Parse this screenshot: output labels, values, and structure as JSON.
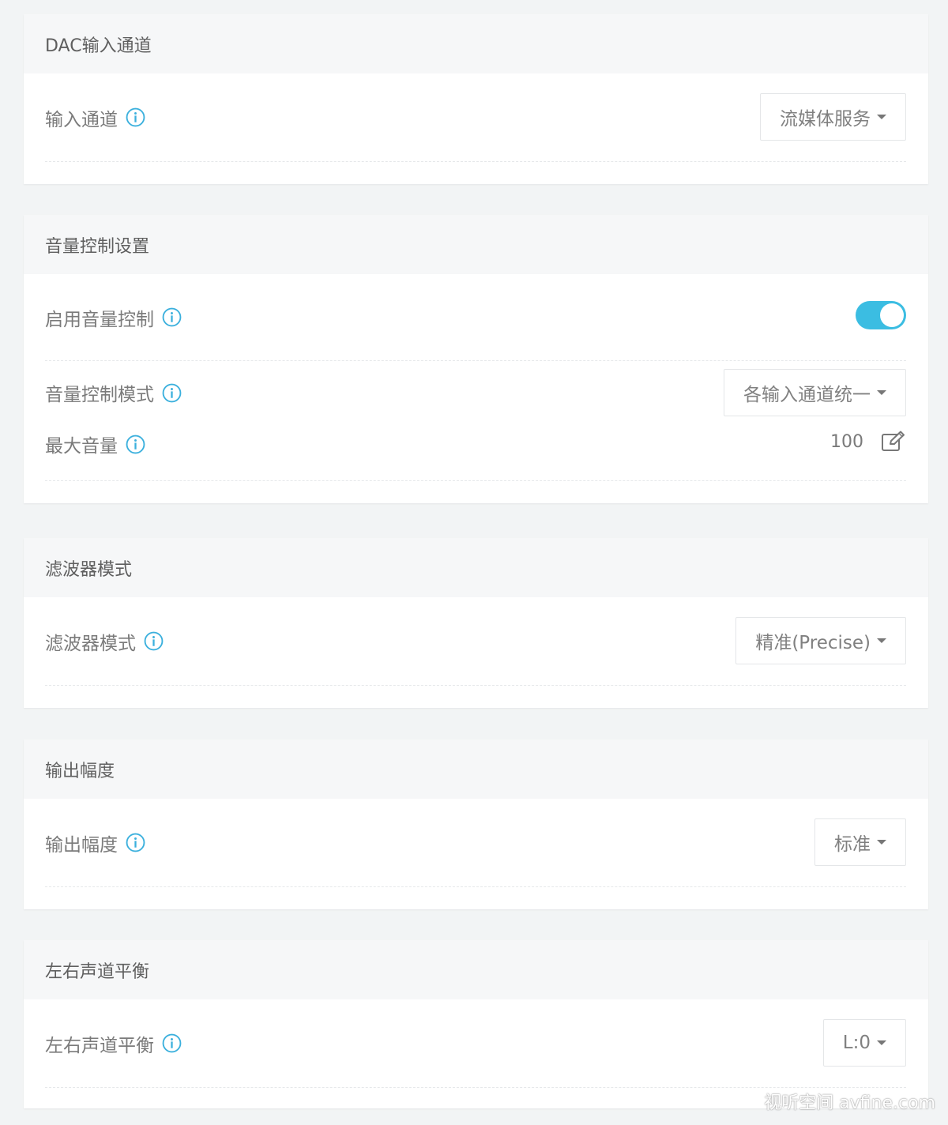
{
  "sections": {
    "dac": {
      "title": "DAC输入通道",
      "input_channel": {
        "label": "输入通道",
        "value": "流媒体服务"
      }
    },
    "volume": {
      "title": "音量控制设置",
      "enable": {
        "label": "启用音量控制",
        "state": "on"
      },
      "mode": {
        "label": "音量控制模式",
        "value": "各输入通道统一"
      },
      "max": {
        "label": "最大音量",
        "value": "100"
      }
    },
    "filter": {
      "title": "滤波器模式",
      "mode": {
        "label": "滤波器模式",
        "value": "精准(Precise)"
      }
    },
    "output": {
      "title": "输出幅度",
      "level": {
        "label": "输出幅度",
        "value": "标准"
      }
    },
    "balance": {
      "title": "左右声道平衡",
      "balance": {
        "label": "左右声道平衡",
        "value": "L:0"
      }
    }
  },
  "colors": {
    "accent": "#3bbde2",
    "page_bg": "#f2f4f5",
    "panel_header_bg": "#f6f7f8"
  },
  "icons": {
    "info": "info-circle-icon",
    "edit": "edit-icon",
    "caret": "caret-down-icon"
  },
  "watermark": "视听空间 avfine.com"
}
